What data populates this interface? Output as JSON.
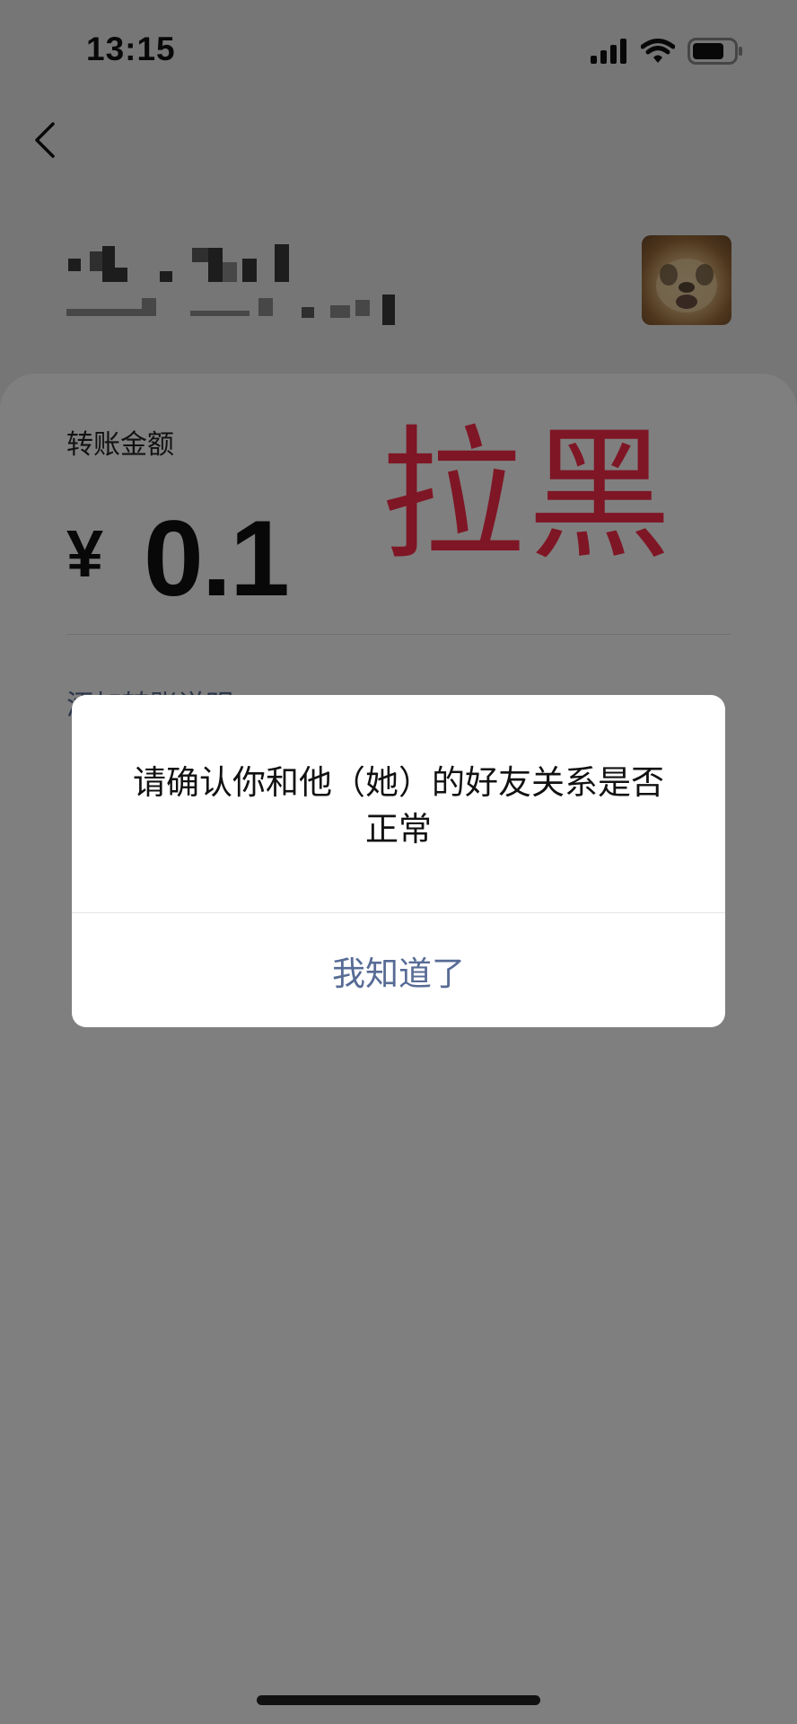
{
  "status_bar": {
    "time": "13:15",
    "icons": [
      "signal-icon",
      "wifi-icon",
      "battery-icon"
    ]
  },
  "nav": {
    "back_icon": "chevron-left-icon"
  },
  "transfer": {
    "amount_label": "转账金额",
    "currency": "¥",
    "amount": "0.1",
    "add_note": "添加转账说明"
  },
  "annotation": {
    "text": "拉黑",
    "color": "#ff2d4a"
  },
  "dialog": {
    "message": "请确认你和他（她）的好友关系是否正常",
    "button": "我知道了"
  },
  "colors": {
    "link": "#576b95",
    "overlay": "rgba(0,0,0,0.5)"
  }
}
